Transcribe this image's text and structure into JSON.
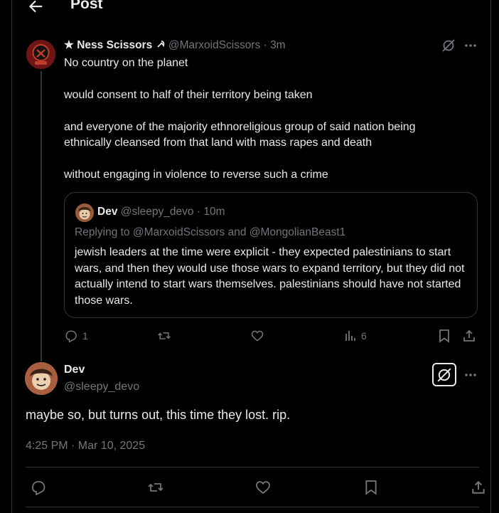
{
  "header": {
    "title": "Post",
    "back_icon": "arrow-left-icon"
  },
  "parent_tweet": {
    "name": "★ Ness Scissors",
    "name_suffix_icon": "hammer-sickle-icon",
    "handle": "@MarxoidScissors",
    "separator": "·",
    "time": "3m",
    "paragraphs": [
      "No country on the planet",
      "would consent to half of their territory being taken",
      "and everyone of the majority ethnoreligious group of said nation being ethnically cleansed from that land with mass rapes and death",
      "without engaging in violence to reverse such a crime"
    ],
    "quote": {
      "name": "Dev",
      "handle": "@sleepy_devo",
      "separator": "·",
      "time": "10m",
      "replying_to": "Replying to @MarxoidScissors and @MongolianBeast1",
      "text": "jewish leaders at the time were explicit - they expected palestinians to start wars, and then they would use those wars to expand territory, but they did not actually intend to start wars themselves. palestinians should have not started those wars."
    },
    "actions": {
      "reply_count": "1",
      "views_count": "6"
    }
  },
  "main_tweet": {
    "name": "Dev",
    "handle": "@sleepy_devo",
    "text": "maybe so, but turns out, this time they lost. rip.",
    "timestamp": "4:25 PM · Mar 10, 2025"
  },
  "colors": {
    "background": "#000000",
    "text": "#e7e9ea",
    "muted": "#71767b",
    "border": "#2f3336"
  }
}
